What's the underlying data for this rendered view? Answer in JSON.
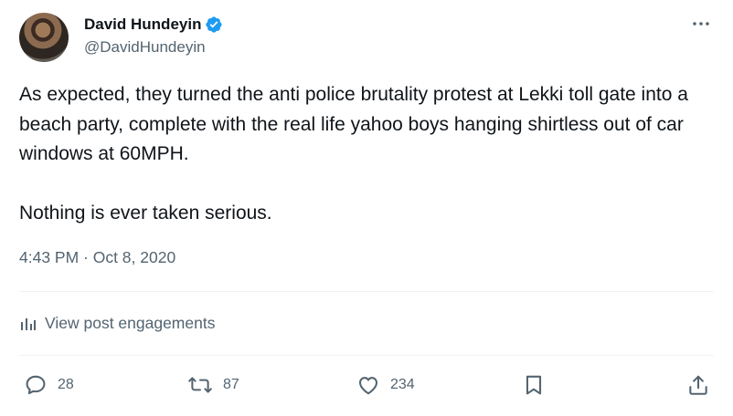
{
  "author": {
    "display_name": "David Hundeyin",
    "handle": "@DavidHundeyin",
    "verified": true
  },
  "tweet": {
    "text": "As expected, they turned the anti police brutality protest at Lekki toll gate into a beach party, complete with the real life yahoo boys hanging shirtless out of car windows at 60MPH.\n\nNothing is ever taken serious.",
    "timestamp": "4:43 PM · Oct 8, 2020"
  },
  "engagements_link": "View post engagements",
  "actions": {
    "replies": "28",
    "reposts": "87",
    "likes": "234"
  },
  "colors": {
    "verified_blue": "#1d9bf0",
    "secondary_text": "#536471",
    "primary_text": "#0f1419"
  },
  "icons": [
    "verified-badge-icon",
    "more-icon",
    "analytics-icon",
    "reply-icon",
    "repost-icon",
    "like-icon",
    "bookmark-icon",
    "share-icon"
  ]
}
